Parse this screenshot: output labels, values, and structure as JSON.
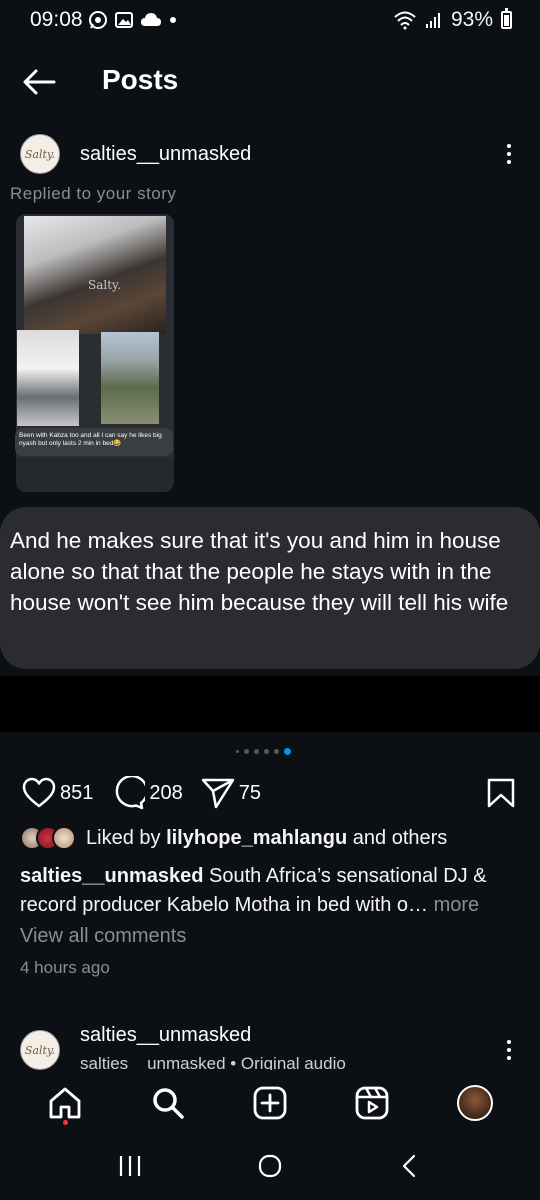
{
  "status_bar": {
    "time": "09:08",
    "battery": "93%",
    "icons": [
      "whatsapp-icon",
      "gallery-icon",
      "cloud-icon",
      "dot-icon",
      "wifi-icon",
      "signal-icon",
      "battery-icon"
    ]
  },
  "header": {
    "title": "Posts"
  },
  "post": {
    "username": "salties__unmasked",
    "avatar_text": "Salty.",
    "replied_label": "Replied to your story",
    "story_watermark": "Salty.",
    "story_caption": "Been with Kabza too and all I can say he likes big nyash but only lasts 2 min in bed😂",
    "reply_text": "And he makes sure that it's you and him in house alone so that that the people he stays with in the house won't see him because they will tell his wife",
    "carousel": {
      "total": 6,
      "active_index": 5
    },
    "likes": "851",
    "comments": "208",
    "shares": "75",
    "liked_by_prefix": "Liked by ",
    "liked_by_user": "lilyhope_mahlangu",
    "liked_by_suffix": " and others",
    "caption_user": "salties__unmasked",
    "caption_text": " South Africa’s sensational DJ & record producer Kabelo Motha in bed with o…",
    "caption_more": " more",
    "view_comments": "View all comments",
    "time_ago": "4 hours ago"
  },
  "next_post": {
    "username": "salties__unmasked",
    "avatar_text": "Salty.",
    "audio": "salties__unmasked • Original audio"
  },
  "colors": {
    "background": "#0c1014",
    "accent_blue": "#0095f6",
    "notification_red": "#ff3040",
    "muted_text": "#8a8d91"
  }
}
